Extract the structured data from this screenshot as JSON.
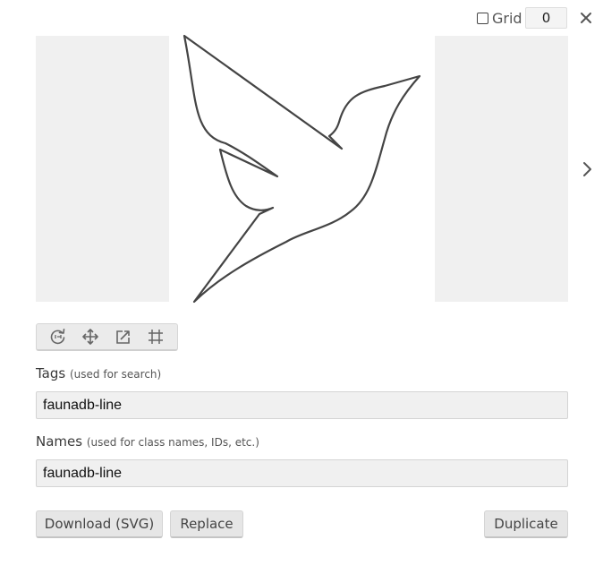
{
  "grid": {
    "label": "Grid",
    "checked": false,
    "value": "0"
  },
  "icons": {
    "close": "close-icon",
    "next": "chevron-right-icon",
    "rotate": "rotate-icon",
    "move": "move-icon",
    "resize": "resize-icon",
    "crop": "crop-grid-icon"
  },
  "tags": {
    "label": "Tags",
    "hint": "(used for search)",
    "value": "faunadb-line"
  },
  "names": {
    "label": "Names",
    "hint": "(used for class names, IDs, etc.)",
    "value": "faunadb-line"
  },
  "buttons": {
    "download": "Download (SVG)",
    "replace": "Replace",
    "duplicate": "Duplicate"
  },
  "colors": {
    "icon_stroke": "#444444",
    "preview_side_bg": "#f0f0f0",
    "input_bg": "#f0f0f0",
    "button_bg": "#e6e6e6"
  }
}
